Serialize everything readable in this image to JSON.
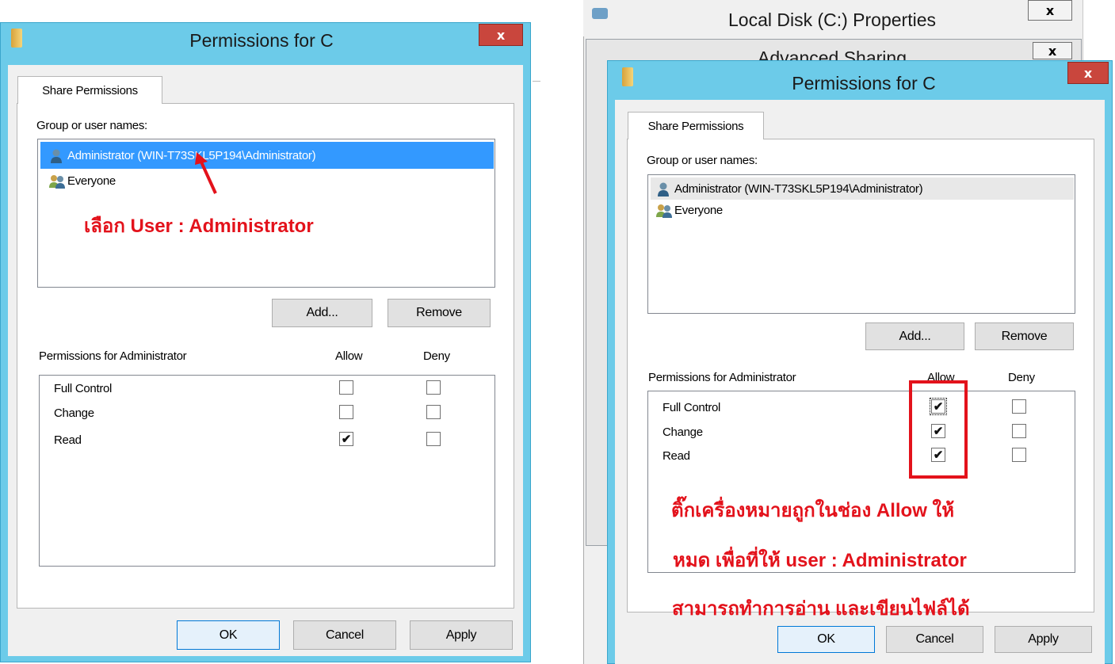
{
  "left_dialog": {
    "title": "Permissions for C",
    "close_label": "x",
    "tab_label": "Share Permissions",
    "group_label": "Group or user names:",
    "users": [
      {
        "name": "Administrator (WIN-T73SKL5P194\\Administrator)",
        "icon": "user-icon",
        "selected": true
      },
      {
        "name": "Everyone",
        "icon": "group-icon",
        "selected": false
      }
    ],
    "add_button": "Add...",
    "remove_button": "Remove",
    "permissions_label": "Permissions for Administrator",
    "allow_header": "Allow",
    "deny_header": "Deny",
    "permissions": [
      {
        "name": "Full Control",
        "allow": false,
        "deny": false
      },
      {
        "name": "Change",
        "allow": false,
        "deny": false
      },
      {
        "name": "Read",
        "allow": true,
        "deny": false
      }
    ],
    "ok_button": "OK",
    "cancel_button": "Cancel",
    "apply_button": "Apply",
    "annotation_prefix": "เลือก ",
    "annotation_bold": "User : Administrator"
  },
  "right_window": {
    "parent_title": "Local Disk (C:) Properties",
    "parent_close": "x",
    "advanced_title": "Advanced Sharing",
    "advanced_close": "x"
  },
  "right_dialog": {
    "title": "Permissions for C",
    "close_label": "x",
    "tab_label": "Share Permissions",
    "group_label": "Group or user names:",
    "users": [
      {
        "name": "Administrator (WIN-T73SKL5P194\\Administrator)",
        "icon": "user-icon"
      },
      {
        "name": "Everyone",
        "icon": "group-icon"
      }
    ],
    "add_button": "Add...",
    "remove_button": "Remove",
    "permissions_label": "Permissions for Administrator",
    "allow_header": "Allow",
    "deny_header": "Deny",
    "permissions": [
      {
        "name": "Full Control",
        "allow": true,
        "deny": false
      },
      {
        "name": "Change",
        "allow": true,
        "deny": false
      },
      {
        "name": "Read",
        "allow": true,
        "deny": false
      }
    ],
    "ok_button": "OK",
    "cancel_button": "Cancel",
    "apply_button": "Apply",
    "annotation_line1_a": "ติ๊กเครื่องหมายถูกในช่อง ",
    "annotation_line1_b": "Allow",
    "annotation_line1_c": " ให้",
    "annotation_line2_a": "หมด เพื่อที่ให้ ",
    "annotation_line2_b": "user : Administrator",
    "annotation_line3": "สามารถทำการอ่าน และเขียนไฟล์ได้"
  },
  "colors": {
    "title_bar": "#6ccbe9",
    "close_red": "#c9463d",
    "selection": "#3399ff",
    "annotation": "#e3121b"
  },
  "check_glyph": "✔"
}
